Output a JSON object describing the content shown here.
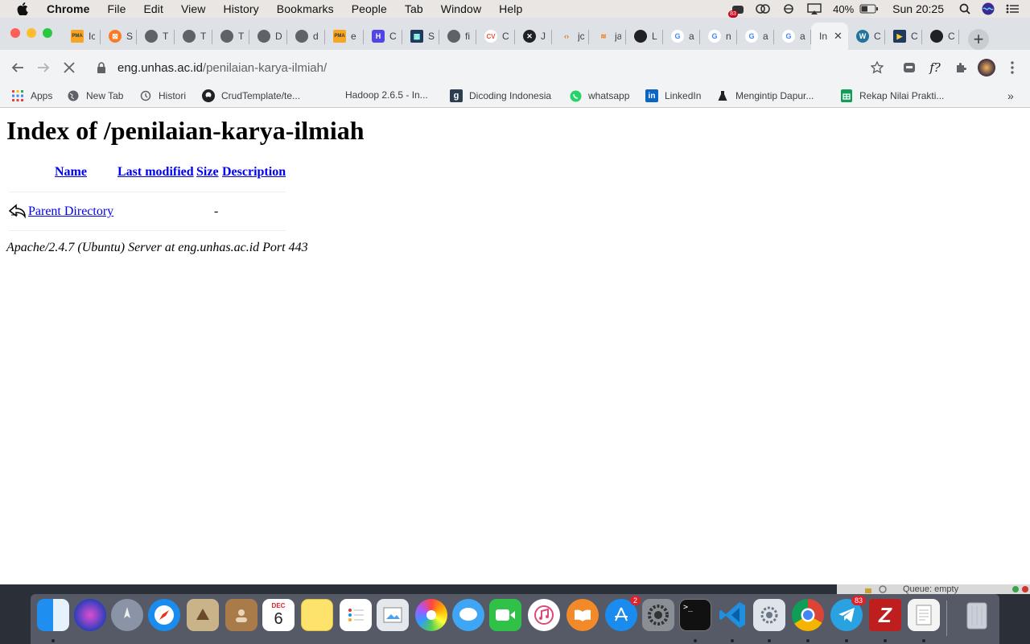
{
  "menubar": {
    "app": "Chrome",
    "items": [
      "File",
      "Edit",
      "View",
      "History",
      "Bookmarks",
      "People",
      "Tab",
      "Window",
      "Help"
    ],
    "battery": "40%",
    "clock": "Sun 20:25",
    "badge": "83"
  },
  "tabs": [
    {
      "title": "Ic",
      "icon": "pma-icon"
    },
    {
      "title": "S",
      "icon": "xampp-icon"
    },
    {
      "title": "T",
      "icon": "globe-icon"
    },
    {
      "title": "T",
      "icon": "globe-icon"
    },
    {
      "title": "T",
      "icon": "globe-icon"
    },
    {
      "title": "D",
      "icon": "globe-icon"
    },
    {
      "title": "d",
      "icon": "globe-icon"
    },
    {
      "title": "e",
      "icon": "pma-icon"
    },
    {
      "title": "C",
      "icon": "hashnode-icon"
    },
    {
      "title": "S",
      "icon": "grid-icon"
    },
    {
      "title": "fi",
      "icon": "globe-icon"
    },
    {
      "title": "C",
      "icon": "cv-icon"
    },
    {
      "title": "J",
      "icon": "ball-icon"
    },
    {
      "title": "jc",
      "icon": "code-icon"
    },
    {
      "title": "ja",
      "icon": "stack-icon"
    },
    {
      "title": "L",
      "icon": "github-icon"
    },
    {
      "title": "a",
      "icon": "google-icon"
    },
    {
      "title": "n",
      "icon": "google-icon"
    },
    {
      "title": "a",
      "icon": "google-icon"
    },
    {
      "title": "a",
      "icon": "google-icon"
    },
    {
      "title": "In",
      "icon": "none",
      "active": true
    },
    {
      "title": "C",
      "icon": "wordpress-icon"
    },
    {
      "title": "C",
      "icon": "play-icon"
    },
    {
      "title": "C",
      "icon": "github-icon"
    }
  ],
  "omnibox": {
    "host": "eng.unhas.ac.id",
    "path": "/penilaian-karya-ilmiah/"
  },
  "bookmarks": [
    {
      "label": "Apps",
      "icon": "apps-grid-icon"
    },
    {
      "label": "New Tab",
      "icon": "globe-icon"
    },
    {
      "label": "Histori",
      "icon": "history-icon"
    },
    {
      "label": "CrudTemplate/te...",
      "icon": "github-icon"
    },
    {
      "label": "Hadoop 2.6.5 - In...",
      "icon": "none"
    },
    {
      "label": "Dicoding Indonesia",
      "icon": "dicoding-icon"
    },
    {
      "label": "whatsapp",
      "icon": "whatsapp-icon"
    },
    {
      "label": "LinkedIn",
      "icon": "linkedin-icon"
    },
    {
      "label": "Mengintip Dapur...",
      "icon": "flask-icon"
    },
    {
      "label": "Rekap Nilai Prakti...",
      "icon": "sheets-icon"
    }
  ],
  "page": {
    "heading": "Index of /penilaian-karya-ilmiah",
    "columns": {
      "name": "Name",
      "modified": "Last modified",
      "size": "Size",
      "description": "Description"
    },
    "rows": [
      {
        "name": "Parent Directory",
        "size": "-"
      }
    ],
    "footer": "Apache/2.4.7 (Ubuntu) Server at eng.unhas.ac.id Port 443"
  },
  "statusbar": {
    "text": "Queue: empty"
  },
  "dock": {
    "calendar_month": "DEC",
    "calendar_day": "6",
    "appstore_badge": "2",
    "telegram_badge": "83",
    "colors": {
      "chrome": "#4285f4",
      "whatsapp": "#25d366",
      "linkedin": "#0a66c2",
      "sheets": "#0f9d58"
    }
  }
}
